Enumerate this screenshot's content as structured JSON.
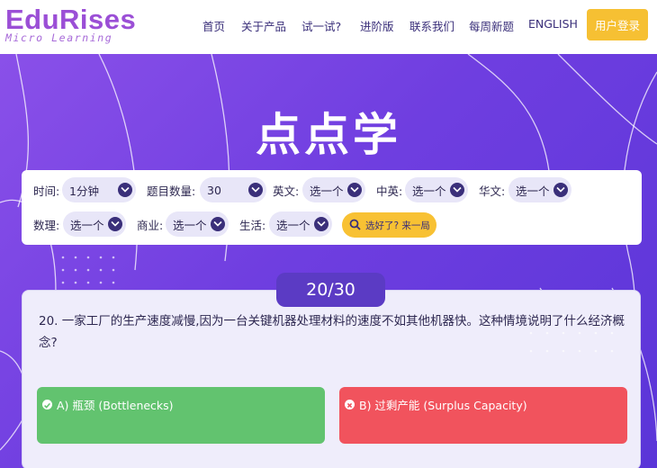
{
  "brand": {
    "name": "EduRises",
    "tagline": "Micro Learning"
  },
  "nav": {
    "items": [
      "首页",
      "关于产品",
      "试一试?",
      "进阶版",
      "联系我们",
      "每周新题",
      "ENGLISH"
    ],
    "login_label": "用户登录"
  },
  "hero": {
    "title": "点点学"
  },
  "filters": {
    "row1": [
      {
        "label": "时间:",
        "value": "1分钟"
      },
      {
        "label": "题目数量:",
        "value": "30"
      },
      {
        "label": "英文:",
        "value": "选一个"
      },
      {
        "label": "中英:",
        "value": "选一个"
      },
      {
        "label": "华文:",
        "value": "选一个"
      }
    ],
    "row2": [
      {
        "label": "数理:",
        "value": "选一个"
      },
      {
        "label": "商业:",
        "value": "选一个"
      },
      {
        "label": "生活:",
        "value": "选一个"
      }
    ],
    "go_label": "选好了? 来一局"
  },
  "quiz": {
    "counter": "20/30",
    "question": "20. 一家工厂的生产速度减慢,因为一台关键机器处理材料的速度不如其他机器快。这种情境说明了什么经济概念?",
    "answers": [
      {
        "label": "A) 瓶颈 (Bottlenecks)",
        "status": "correct"
      },
      {
        "label": "B) 过剩产能 (Surplus Capacity)",
        "status": "wrong"
      }
    ]
  },
  "colors": {
    "brand": "#9b4fd6",
    "accent": "#f6c033",
    "correct": "#62c36f",
    "wrong": "#f1535d",
    "counter": "#5b3bc4"
  }
}
